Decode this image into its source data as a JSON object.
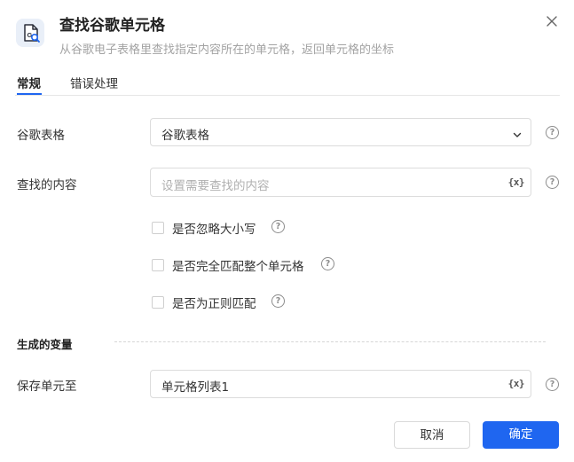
{
  "dialog": {
    "title": "查找谷歌单元格",
    "subtitle": "从谷歌电子表格里查找指定内容所在的单元格，返回单元格的坐标",
    "icon": "spreadsheet-search-icon"
  },
  "tabs": [
    {
      "label": "常规",
      "active": true
    },
    {
      "label": "错误处理",
      "active": false
    }
  ],
  "form": {
    "sheet": {
      "label": "谷歌表格",
      "value": "谷歌表格"
    },
    "content": {
      "label": "查找的内容",
      "placeholder": "设置需要查找的内容",
      "var_label": "{x}"
    },
    "options": [
      {
        "label": "是否忽略大小写",
        "checked": false
      },
      {
        "label": "是否完全匹配整个单元格",
        "checked": false
      },
      {
        "label": "是否为正则匹配",
        "checked": false
      }
    ],
    "output_section": "生成的变量",
    "save": {
      "label": "保存单元至",
      "value": "单元格列表1",
      "var_label": "{x}"
    }
  },
  "footer": {
    "cancel": "取消",
    "confirm": "确定"
  },
  "colors": {
    "primary": "#1f66f0",
    "icon_bg": "#e9eff8"
  }
}
